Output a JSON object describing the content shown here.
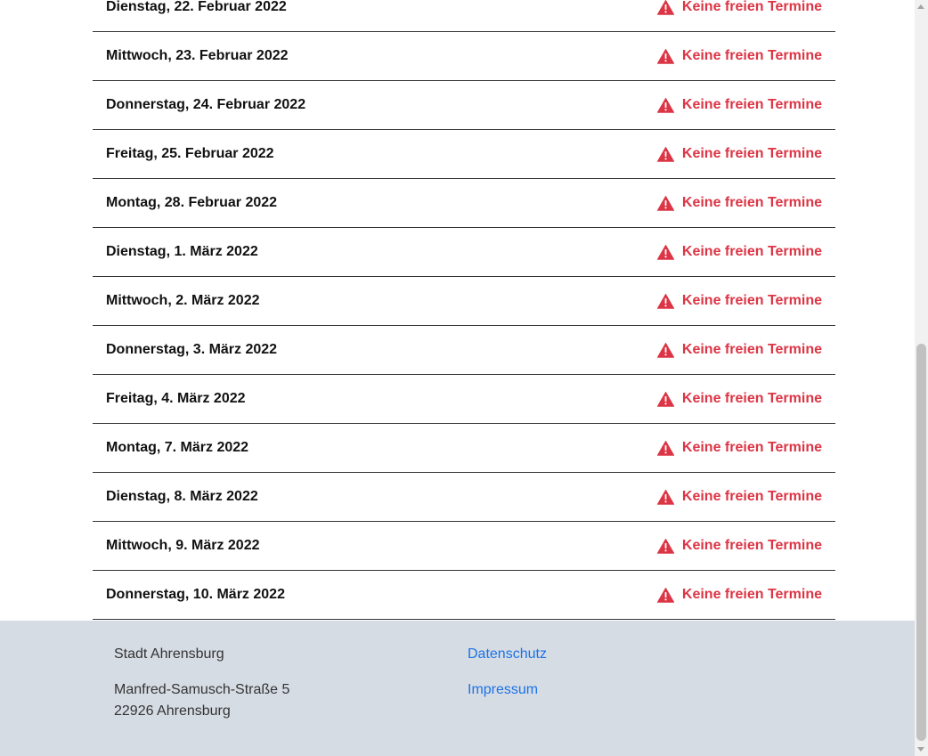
{
  "days": [
    {
      "date": "Dienstag, 22. Februar 2022",
      "status": "Keine freien Termine"
    },
    {
      "date": "Mittwoch, 23. Februar 2022",
      "status": "Keine freien Termine"
    },
    {
      "date": "Donnerstag, 24. Februar 2022",
      "status": "Keine freien Termine"
    },
    {
      "date": "Freitag, 25. Februar 2022",
      "status": "Keine freien Termine"
    },
    {
      "date": "Montag, 28. Februar 2022",
      "status": "Keine freien Termine"
    },
    {
      "date": "Dienstag, 1. März 2022",
      "status": "Keine freien Termine"
    },
    {
      "date": "Mittwoch, 2. März 2022",
      "status": "Keine freien Termine"
    },
    {
      "date": "Donnerstag, 3. März 2022",
      "status": "Keine freien Termine"
    },
    {
      "date": "Freitag, 4. März 2022",
      "status": "Keine freien Termine"
    },
    {
      "date": "Montag, 7. März 2022",
      "status": "Keine freien Termine"
    },
    {
      "date": "Dienstag, 8. März 2022",
      "status": "Keine freien Termine"
    },
    {
      "date": "Mittwoch, 9. März 2022",
      "status": "Keine freien Termine"
    },
    {
      "date": "Donnerstag, 10. März 2022",
      "status": "Keine freien Termine"
    }
  ],
  "status_icon": "warning-triangle-icon",
  "colors": {
    "status_red": "#dc3545",
    "footer_bg": "#d6dce4",
    "link_blue": "#1a73e8"
  },
  "footer": {
    "city": "Stadt Ahrensburg",
    "street": "Manfred-Samusch-Straße 5",
    "zip_city": "22926 Ahrensburg",
    "links": {
      "privacy": "Datenschutz",
      "imprint": "Impressum"
    }
  }
}
